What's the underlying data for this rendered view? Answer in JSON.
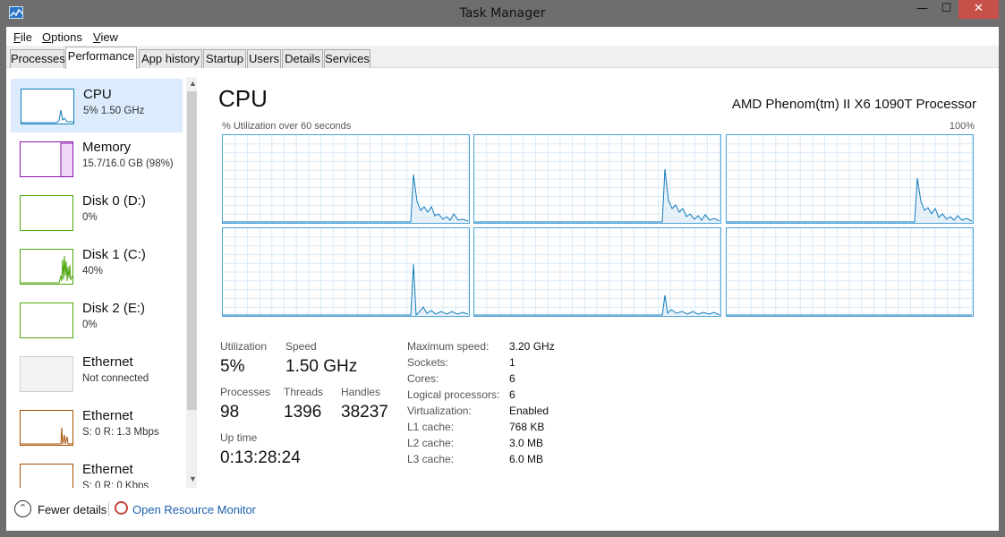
{
  "window": {
    "title": "Task Manager",
    "min_glyph": "—",
    "max_glyph": "☐",
    "close_glyph": "✕"
  },
  "menu": [
    {
      "label": "File",
      "key": "F"
    },
    {
      "label": "Options",
      "key": "O"
    },
    {
      "label": "View",
      "key": "V"
    }
  ],
  "tabs": [
    {
      "label": "Processes"
    },
    {
      "label": "Performance",
      "active": true
    },
    {
      "label": "App history"
    },
    {
      "label": "Startup"
    },
    {
      "label": "Users"
    },
    {
      "label": "Details"
    },
    {
      "label": "Services"
    }
  ],
  "sidebar": {
    "items": [
      {
        "title": "CPU",
        "subtitle": "5%  1.50 GHz",
        "color": "#117dbb",
        "active": true
      },
      {
        "title": "Memory",
        "subtitle": "15.7/16.0 GB (98%)",
        "color": "#8b12ae"
      },
      {
        "title": "Disk 0 (D:)",
        "subtitle": "0%",
        "color": "#4da60c"
      },
      {
        "title": "Disk 1 (C:)",
        "subtitle": "40%",
        "color": "#4da60c"
      },
      {
        "title": "Disk 2 (E:)",
        "subtitle": "0%",
        "color": "#4da60c"
      },
      {
        "title": "Ethernet",
        "subtitle": "Not connected",
        "color": "#bfbfbf"
      },
      {
        "title": "Ethernet",
        "subtitle": "S: 0  R: 1.3 Mbps",
        "color": "#a74f01"
      },
      {
        "title": "Ethernet",
        "subtitle": "S: 0  R: 0 Kbps",
        "color": "#a74f01"
      }
    ],
    "scroll_up": "▲",
    "scroll_down": "▼"
  },
  "main": {
    "title": "CPU",
    "processor": "AMD Phenom(tm) II X6 1090T Processor",
    "util_label": "% Utilization over 60 seconds",
    "util_max": "100%",
    "graph_color": "#117dbb",
    "stats": {
      "utilization_label": "Utilization",
      "utilization": "5%",
      "speed_label": "Speed",
      "speed": "1.50 GHz",
      "processes_label": "Processes",
      "processes": "98",
      "threads_label": "Threads",
      "threads": "1396",
      "handles_label": "Handles",
      "handles": "38237",
      "uptime_label": "Up time",
      "uptime": "0:13:28:24"
    },
    "details": [
      {
        "label": "Maximum speed:",
        "value": "3.20 GHz"
      },
      {
        "label": "Sockets:",
        "value": "1"
      },
      {
        "label": "Cores:",
        "value": "6"
      },
      {
        "label": "Logical processors:",
        "value": "6"
      },
      {
        "label": "Virtualization:",
        "value": "Enabled"
      },
      {
        "label": "L1 cache:",
        "value": "768 KB"
      },
      {
        "label": "L2 cache:",
        "value": "3.0 MB"
      },
      {
        "label": "L3 cache:",
        "value": "6.0 MB"
      }
    ]
  },
  "footer": {
    "fewer_details": "Fewer details",
    "resource_monitor": "Open Resource Monitor"
  }
}
